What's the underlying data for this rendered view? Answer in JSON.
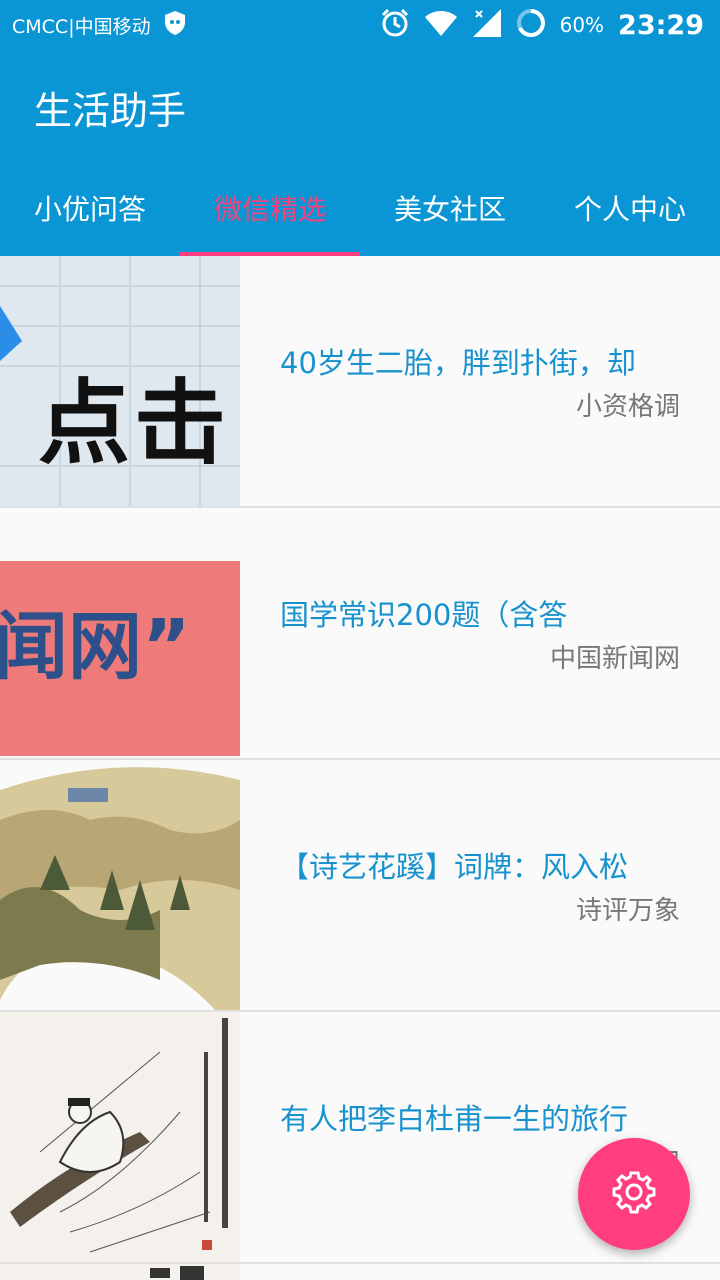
{
  "status_bar": {
    "carrier": "CMCC|中国移动",
    "battery": "60%",
    "time": "23:29",
    "icons": [
      "shield-icon",
      "alarm-icon",
      "wifi-icon",
      "signal-icon",
      "battery-icon"
    ]
  },
  "app": {
    "title": "生活助手"
  },
  "tabs": [
    {
      "label": "小优问答",
      "active": false
    },
    {
      "label": "微信精选",
      "active": true
    },
    {
      "label": "美女社区",
      "active": false
    },
    {
      "label": "个人中心",
      "active": false
    }
  ],
  "articles": [
    {
      "title": "40岁生二胎，胖到扑街，却",
      "source": "小资格调",
      "thumb_text": "点击"
    },
    {
      "title": "国学常识200题（含答",
      "source": "中国新闻网",
      "thumb_text": "闻网”"
    },
    {
      "title": "【诗艺花蹊】词牌：风入松",
      "source": "诗评万象"
    },
    {
      "title": "有人把李白杜甫一生的旅行",
      "source": "和"
    }
  ],
  "fab": {
    "icon": "gear-icon"
  },
  "colors": {
    "primary": "#0a96d4",
    "accent": "#ff3d7f",
    "title_text": "#1792ce"
  }
}
